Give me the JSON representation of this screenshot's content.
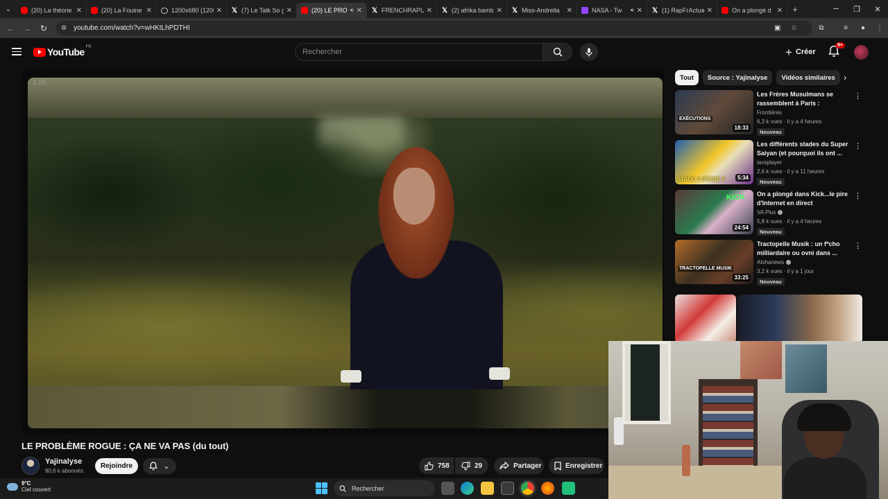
{
  "browser": {
    "tabs": [
      {
        "icon": "youtube",
        "title": "(20) La théorie"
      },
      {
        "icon": "youtube",
        "title": "(20) La Fouine"
      },
      {
        "icon": "globe",
        "title": "1200x680 (1200"
      },
      {
        "icon": "x",
        "title": "(7) Le Talk So g"
      },
      {
        "icon": "youtube",
        "title": "(20) LE PRO",
        "active": true
      },
      {
        "icon": "x",
        "title": "FRENCHRAPUS"
      },
      {
        "icon": "x",
        "title": "(2) afrika bamb"
      },
      {
        "icon": "x",
        "title": "Miss-Andrella"
      },
      {
        "icon": "twitch",
        "title": "NASA - Tw"
      },
      {
        "icon": "x",
        "title": "(1) RapFrActua"
      },
      {
        "icon": "youtube",
        "title": "On a plongé d"
      }
    ],
    "url": "youtube.com/watch?v=wHKtLhPDTHI"
  },
  "youtube": {
    "logo_text": "YouTube",
    "country_code": "FR",
    "search_placeholder": "Rechercher",
    "create_label": "Créer",
    "notifications_badge": "9+"
  },
  "player": {
    "speed_label": "1.50"
  },
  "video": {
    "title": "LE PROBLÈME ROGUE : ÇA NE VA PAS (du tout)",
    "channel_name": "Yajinalyse",
    "subscribers": "90,6 k abonnés",
    "join_label": "Rejoindre",
    "likes": "758",
    "dislikes": "29",
    "share_label": "Partager",
    "save_label": "Enregistrer"
  },
  "sidebar": {
    "chips": [
      "Tout",
      "Source : Yajinalyse",
      "Vidéos similaires"
    ],
    "recommendations": [
      {
        "title": "Les Frères Musulmans se rassemblent à Paris : immersi...",
        "channel": "Frontières",
        "verified": false,
        "meta": "6,3 k vues · il y a 4 heures",
        "badge": "Nouveau",
        "duration": "18:33",
        "thumb_text": "EXÉCUTIONS"
      },
      {
        "title": "Les différents stades du Super Saiyan (et pourquoi ils ont ...",
        "channel": "iavsplayer",
        "verified": false,
        "meta": "2,6 k vues · il y a 11 heures",
        "badge": "Nouveau",
        "duration": "5:34",
        "thumb_text": "STADE 2 STADE 3"
      },
      {
        "title": "On a plongé dans Kick...le pire d'Internet en direct",
        "channel": "VA Plus",
        "verified": true,
        "meta": "5,8 k vues · il y a 4 heures",
        "badge": "Nouveau",
        "duration": "24:54",
        "thumb_text": "KICK"
      },
      {
        "title": "Tractopelle Musik : un f*cho milliardaire ou ovni dans ...",
        "channel": "Alohanews",
        "verified": true,
        "meta": "3,2 k vues · il y a 1 jour",
        "badge": "Nouveau",
        "duration": "33:25",
        "thumb_text": "TRACTOPELLE MUSIK"
      }
    ]
  },
  "taskbar": {
    "temperature": "9°C",
    "condition": "Ciel couvert",
    "search_placeholder": "Rechercher"
  },
  "colors": {
    "youtube_red": "#ff0000",
    "background": "#0f0f0f",
    "chip_bg": "#272727",
    "windows_accent": "#4cc2ff"
  }
}
